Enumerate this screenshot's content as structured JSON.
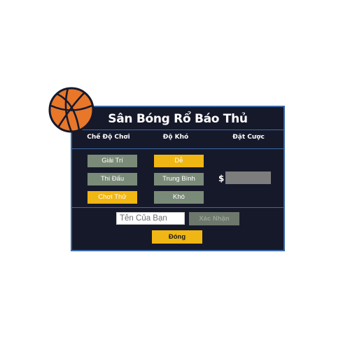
{
  "dialog": {
    "title": "Sân Bóng Rổ Báo Thủ",
    "columns": {
      "mode_header": "Chế Độ Chơi",
      "difficulty_header": "Độ Khó",
      "bet_header": "Đặt Cược"
    },
    "modes": [
      {
        "label": "Giải Trí",
        "selected": false
      },
      {
        "label": "Thi Đấu",
        "selected": false
      },
      {
        "label": "Chơi Thử",
        "selected": true
      }
    ],
    "difficulties": [
      {
        "label": "Dễ",
        "selected": true
      },
      {
        "label": "Trung Bình",
        "selected": false
      },
      {
        "label": "Khó",
        "selected": false
      }
    ],
    "bet": {
      "currency_symbol": "$",
      "value": ""
    },
    "name_input": {
      "placeholder": "Tên Của Bạn",
      "value": ""
    },
    "confirm_label": "Xác Nhận",
    "close_label": "Đóng"
  },
  "colors": {
    "panel_bg": "#16192a",
    "panel_border": "#3c6aa5",
    "accent_yellow": "#f0b614",
    "button_gray": "#7a8a78",
    "basketball_orange": "#e8772a"
  },
  "icons": {
    "basketball": "basketball-icon"
  }
}
